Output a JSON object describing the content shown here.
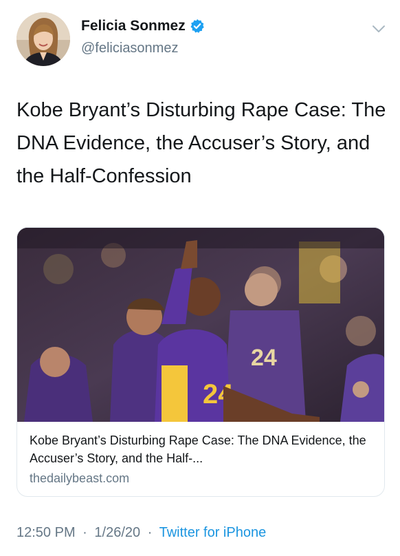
{
  "author": {
    "name": "Felicia Sonmez",
    "handle": "@feliciasonmez",
    "verified": true
  },
  "tweet": {
    "text": "Kobe Bryant’s Disturbing Rape Case: The DNA Evidence, the Accuser’s Story, and the Half-Confession"
  },
  "card": {
    "image_icon": "basketball-player-photo",
    "title": "Kobe Bryant’s Disturbing Rape Case: The DNA Evidence, the Accuser’s Story, and the Half-...",
    "domain": "thedailybeast.com"
  },
  "meta": {
    "time": "12:50 PM",
    "date": "1/26/20",
    "separator": "·",
    "source": "Twitter for iPhone"
  },
  "colors": {
    "accent": "#1b95e0",
    "text": "#14171a",
    "muted": "#657786",
    "verified": "#1da1f2",
    "border": "#e1e8ed"
  }
}
